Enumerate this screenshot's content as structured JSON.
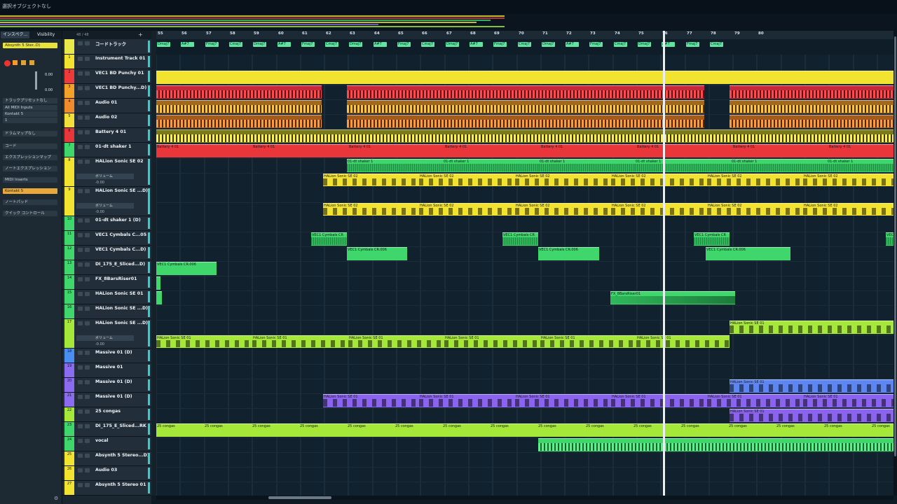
{
  "status_text": "選択オブジェクトなし",
  "inspector": {
    "tabs": [
      "インスペク...",
      "Visibility"
    ],
    "instrument_name": "Absynth 5 Ster..D)",
    "value_a": "0.00",
    "value_b": "0.00",
    "rows": [
      "トラックプリセットなし",
      "All MIDI Inputs",
      "Kontakt 5",
      "1",
      "ドラムマップなし",
      "コード",
      "エクスプレッションマップ",
      "ノートエクスプレッション",
      "MIDI Inserts",
      "Kontakt 5",
      "ノートパッド",
      "クイック コントロール"
    ]
  },
  "tracklist": {
    "counter": "48 / 48",
    "tracks": [
      {
        "num": "",
        "name": "コードトラック",
        "color": "#e9ea4a",
        "h": 22
      },
      {
        "num": "1",
        "name": "Instrument Track 01",
        "color": "#f3e331",
        "h": 21
      },
      {
        "num": "2",
        "name": "VEC1 BD Punchy 01",
        "color": "#ef3a3a",
        "h": 21
      },
      {
        "num": "3",
        "name": "VEC1 BD Punchy...D)",
        "color": "#f4a12a",
        "h": 21
      },
      {
        "num": "4",
        "name": "Audio 01",
        "color": "#f08a2a",
        "h": 21
      },
      {
        "num": "5",
        "name": "Audio 02",
        "color": "#f2e03a",
        "h": 21
      },
      {
        "num": "6",
        "name": "Battery 4 01",
        "color": "#e8363a",
        "h": 21
      },
      {
        "num": "7",
        "name": "01-dt shaker 1",
        "color": "#3fd66b",
        "h": 21
      },
      {
        "num": "8",
        "name": "HALion Sonic SE 02",
        "color": "#f3e331",
        "h": 42
      },
      {
        "num": "9",
        "name": "HALion Sonic SE ...D)",
        "color": "#f3e331",
        "h": 42
      },
      {
        "num": "10",
        "name": "01-dt shaker 1 (D)",
        "color": "#3fd66b",
        "h": 21
      },
      {
        "num": "11",
        "name": "VEC1 Cymbals C...05",
        "color": "#3fd66b",
        "h": 21
      },
      {
        "num": "12",
        "name": "VEC1 Cymbals C...D)",
        "color": "#3fd66b",
        "h": 21
      },
      {
        "num": "13",
        "name": "DI_175_E_Sliced...D)",
        "color": "#3fd66b",
        "h": 21
      },
      {
        "num": "14",
        "name": "FX_8BarsRiser01",
        "color": "#3fd66b",
        "h": 21
      },
      {
        "num": "15",
        "name": "HALion Sonic SE 01",
        "color": "#3fd66b",
        "h": 21
      },
      {
        "num": "16",
        "name": "HALion Sonic SE ...D)",
        "color": "#3fd66b",
        "h": 21
      },
      {
        "num": "17",
        "name": "HALion Sonic SE ...D)",
        "color": "#a6e83a",
        "h": 42
      },
      {
        "num": "18",
        "name": "Massive 01 (D)",
        "color": "#4a8ff0",
        "h": 21
      },
      {
        "num": "19",
        "name": "Massive 01",
        "color": "#8b6cf0",
        "h": 21
      },
      {
        "num": "20",
        "name": "Massive 01 (D)",
        "color": "#8b6cf0",
        "h": 21
      },
      {
        "num": "21",
        "name": "Massive 01 (D)",
        "color": "#8b6cf0",
        "h": 21
      },
      {
        "num": "22",
        "name": "25 congas",
        "color": "#a6e83a",
        "h": 21
      },
      {
        "num": "23",
        "name": "DI_175_E_Sliced...RK",
        "color": "#3fd66b",
        "h": 21
      },
      {
        "num": "24",
        "name": "vocal",
        "color": "#3fd66b",
        "h": 21
      },
      {
        "num": "25",
        "name": "Absynth 5 Stereo...D)",
        "color": "#f3e331",
        "h": 21
      },
      {
        "num": "26",
        "name": "Audio 03",
        "color": "#f3e331",
        "h": 21
      },
      {
        "num": "27",
        "name": "Absynth 5 Stereo 01",
        "color": "#f3e331",
        "h": 21
      }
    ],
    "auto_label": "ボリューム",
    "auto_value": "-0.00"
  },
  "ruler": {
    "ticks": [
      "55",
      "56",
      "57",
      "58",
      "59",
      "60",
      "61",
      "62",
      "63",
      "64",
      "65",
      "66",
      "67",
      "68",
      "69",
      "70",
      "71",
      "72",
      "73",
      "74",
      "75",
      "76",
      "77",
      "78",
      "79",
      "80"
    ]
  },
  "chords": [
    "Dmaj7",
    "A#7",
    "Fmaj7",
    "Cmaj7",
    "Dmaj7",
    "A#7",
    "Fmaj7",
    "Cmaj7",
    "Dmaj7",
    "A#7",
    "Fmaj7",
    "Cmaj7",
    "Dmaj7",
    "A#7",
    "Fmaj7",
    "Cmaj7",
    "Dmaj7",
    "A#7",
    "Fmaj7",
    "Cmaj7",
    "Dmaj7",
    "A#7",
    "Fmaj7",
    "Cmaj7"
  ],
  "event_labels": {
    "battery": "Battery 4 01",
    "shaker": "01-dt shaker 1",
    "halion2": "HALion Sonic SE 02",
    "cym_r": "VEC1 Cymbals CR",
    "cym_006": "VEC1 Cymbals CR.006",
    "riser": "FX_8BarsRiser01",
    "halion1": "HALion Sonic SE 01",
    "congas": "25 congas"
  },
  "colors": {
    "yellow": "#f3e331",
    "red": "#e8363a",
    "green": "#3fd66b",
    "lime": "#a6e83a",
    "blue": "#5d86f3",
    "purple": "#8a63ee"
  }
}
